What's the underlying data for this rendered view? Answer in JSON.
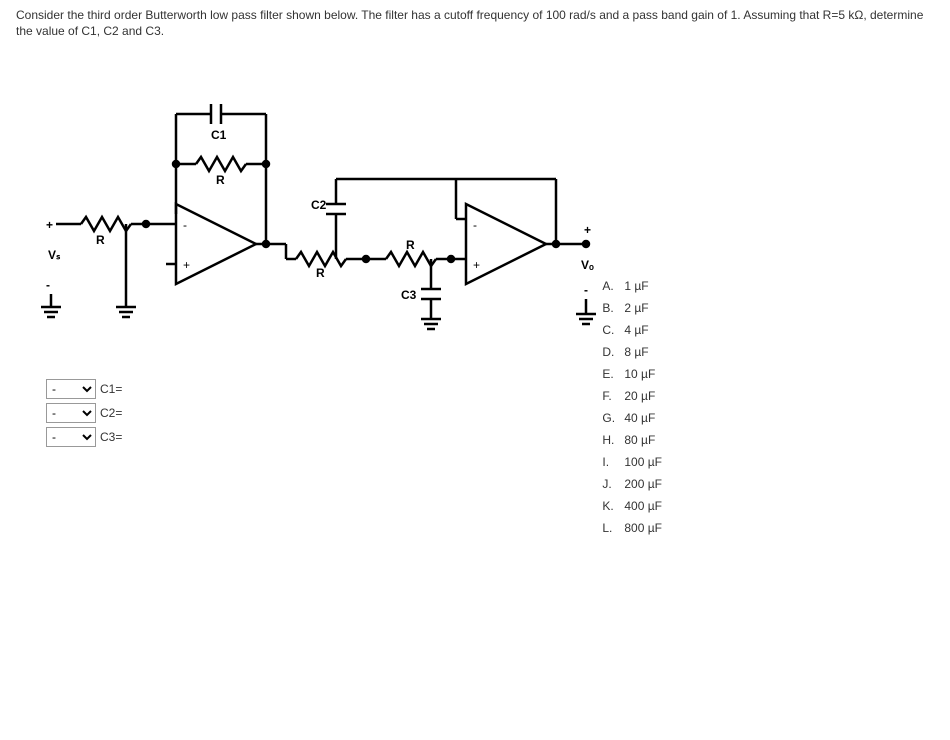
{
  "question": {
    "text": "Consider the third order Butterworth low pass filter shown below. The filter has a cutoff frequency of 100 rad/s and a pass band gain of 1. Assuming that R=5 kΩ, determine the value of C1, C2 and C3."
  },
  "circuit_labels": {
    "c1": "C1",
    "c2": "C2",
    "c3": "C3",
    "r": "R",
    "vs": "Vₛ",
    "vo": "Vₒ",
    "plus": "+",
    "minus": "-"
  },
  "selects": {
    "placeholder": "-",
    "items": [
      {
        "label": "C1="
      },
      {
        "label": "C2="
      },
      {
        "label": "C3="
      }
    ]
  },
  "options": [
    {
      "letter": "A.",
      "value": "1 µF"
    },
    {
      "letter": "B.",
      "value": "2 µF"
    },
    {
      "letter": "C.",
      "value": "4 µF"
    },
    {
      "letter": "D.",
      "value": "8 µF"
    },
    {
      "letter": "E.",
      "value": "10 µF"
    },
    {
      "letter": "F.",
      "value": "20 µF"
    },
    {
      "letter": "G.",
      "value": "40 µF"
    },
    {
      "letter": "H.",
      "value": "80 µF"
    },
    {
      "letter": "I.",
      "value": "100 µF"
    },
    {
      "letter": "J.",
      "value": "200 µF"
    },
    {
      "letter": "K.",
      "value": "400 µF"
    },
    {
      "letter": "L.",
      "value": "800 µF"
    }
  ]
}
